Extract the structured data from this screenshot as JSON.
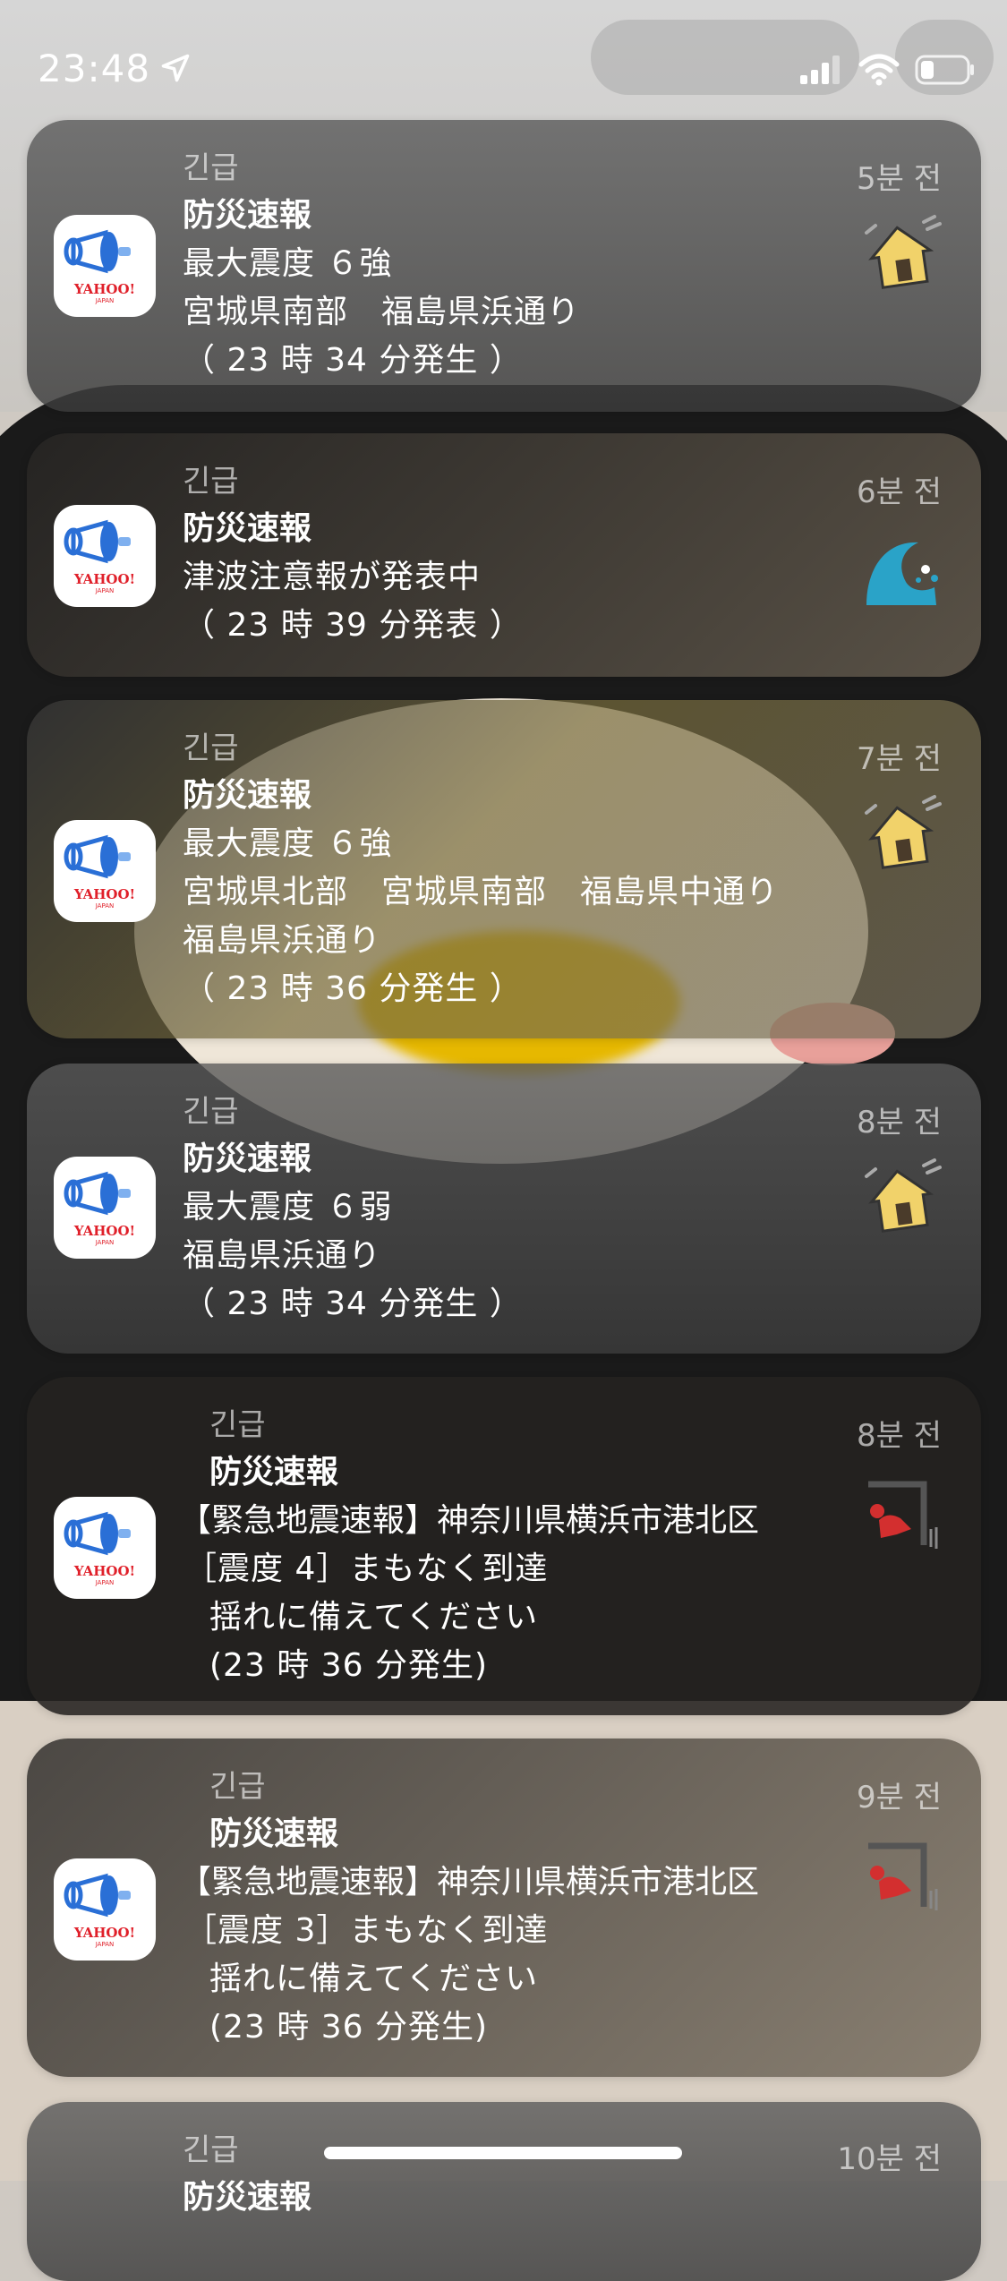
{
  "status_bar": {
    "time": "23:48"
  },
  "notifications": [
    {
      "label": "긴급",
      "title": "防災速報",
      "lines": [
        "最大震度 ６強",
        "宮城県南部　福島県浜通り",
        "（ 23 時 34 分発生 ）"
      ],
      "time_ago": "5분 전",
      "thumbnail": "earthquake-house-icon"
    },
    {
      "label": "긴급",
      "title": "防災速報",
      "lines": [
        "津波注意報が発表中",
        "（ 23 時 39 分発表 ）"
      ],
      "time_ago": "6분 전",
      "thumbnail": "tsunami-wave-icon"
    },
    {
      "label": "긴급",
      "title": "防災速報",
      "lines": [
        "最大震度 ６強",
        "宮城県北部　宮城県南部　福島県中通り",
        "福島県浜通り",
        "（ 23 時 36 分発生 ）"
      ],
      "time_ago": "7분 전",
      "thumbnail": "earthquake-house-icon"
    },
    {
      "label": "긴급",
      "title": "防災速報",
      "lines": [
        "最大震度 ６弱",
        "福島県浜通り",
        "（ 23 時 34 分発生 ）"
      ],
      "time_ago": "8분 전",
      "thumbnail": "earthquake-house-icon"
    },
    {
      "label": "긴급",
      "title": "防災速報",
      "lines": [
        "【緊急地震速報】神奈川県横浜市港北区",
        "［震度 4］まもなく到達",
        "揺れに備えてください",
        "(23 時 36 分発生)"
      ],
      "time_ago": "8분 전",
      "thumbnail": "take-cover-icon"
    },
    {
      "label": "긴급",
      "title": "防災速報",
      "lines": [
        "【緊急地震速報】神奈川県横浜市港北区",
        "［震度 3］まもなく到達",
        "揺れに備えてください",
        "(23 時 36 分発生)"
      ],
      "time_ago": "9분 전",
      "thumbnail": "take-cover-icon"
    },
    {
      "label": "긴급",
      "title": "防災速報",
      "lines": [],
      "time_ago": "10분 전",
      "thumbnail": ""
    }
  ],
  "app_icon": {
    "brand": "YAHOO!",
    "sub": "JAPAN",
    "brand_color": "#e0202a",
    "megaphone_color": "#2a6fd6"
  }
}
